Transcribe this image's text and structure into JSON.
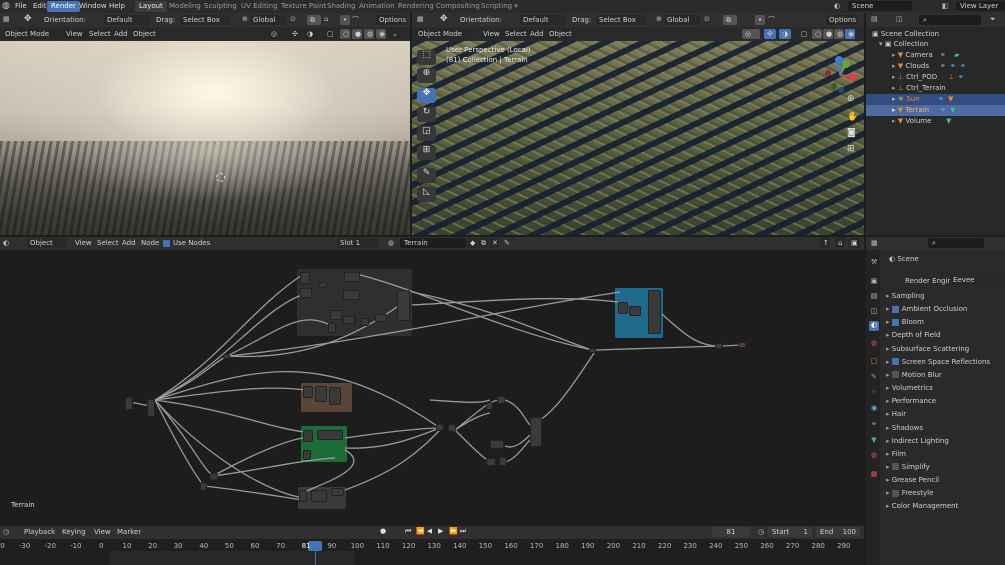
{
  "topbar": {
    "menus": [
      "File",
      "Edit",
      "Render",
      "Window",
      "Help"
    ],
    "workspaces": [
      "Layout",
      "Modeling",
      "Sculpting",
      "UV Editing",
      "Texture Paint",
      "Shading",
      "Animation",
      "Rendering",
      "Compositing",
      "Scripting"
    ],
    "active_workspace": "Layout",
    "scene": "Scene",
    "view_layer": "View Layer"
  },
  "viewport_left": {
    "orientation_label": "Orientation:",
    "orientation_value": "Default",
    "drag_label": "Drag:",
    "drag_value": "Select Box",
    "transform": "Global",
    "options": "Options",
    "mode": "Object Mode",
    "menus": [
      "View",
      "Select",
      "Add",
      "Object"
    ]
  },
  "viewport_right": {
    "orientation_label": "Orientation:",
    "orientation_value": "Default",
    "drag_label": "Drag:",
    "drag_value": "Select Box",
    "transform": "Global",
    "options": "Options",
    "mode": "Object Mode",
    "menus": [
      "View",
      "Select",
      "Add",
      "Object"
    ],
    "overlay_line1": "User Perspective (Local)",
    "overlay_line2": "(81) Collection | Terrain"
  },
  "outliner": {
    "root": "Scene Collection",
    "collection": "Collection",
    "items": [
      "Camera",
      "Clouds",
      "Ctrl_POD",
      "Ctrl_Terrain",
      "Sun",
      "Terrain",
      "Volume"
    ]
  },
  "node_editor": {
    "type": "Object",
    "menus": [
      "View",
      "Select",
      "Add",
      "Node"
    ],
    "use_nodes": "Use Nodes",
    "slot": "Slot 1",
    "material": "Terrain",
    "corner_label": "Terrain"
  },
  "properties": {
    "context": "Scene",
    "render_engine_label": "Render Engine",
    "render_engine_value": "Eevee",
    "sections": [
      {
        "label": "Sampling",
        "check": null
      },
      {
        "label": "Ambient Occlusion",
        "check": true
      },
      {
        "label": "Bloom",
        "check": true
      },
      {
        "label": "Depth of Field",
        "check": null
      },
      {
        "label": "Subsurface Scattering",
        "check": null
      },
      {
        "label": "Screen Space Reflections",
        "check": true
      },
      {
        "label": "Motion Blur",
        "check": false
      },
      {
        "label": "Volumetrics",
        "check": null
      },
      {
        "label": "Performance",
        "check": null
      },
      {
        "label": "Hair",
        "check": null
      },
      {
        "label": "Shadows",
        "check": null
      },
      {
        "label": "Indirect Lighting",
        "check": null
      },
      {
        "label": "Film",
        "check": null
      },
      {
        "label": "Simplify",
        "check": false
      },
      {
        "label": "Grease Pencil",
        "check": null
      },
      {
        "label": "Freestyle",
        "check": false
      },
      {
        "label": "Color Management",
        "check": null
      }
    ]
  },
  "timeline": {
    "menus": [
      "Playback",
      "Keying",
      "View",
      "Marker"
    ],
    "current_frame": "81",
    "start_label": "Start",
    "start_value": "1",
    "end_label": "End",
    "end_value": "100",
    "ruler": [
      "-40",
      "-30",
      "-20",
      "-10",
      "0",
      "10",
      "20",
      "30",
      "40",
      "50",
      "60",
      "70",
      "81",
      "90",
      "100",
      "110",
      "120",
      "130",
      "140",
      "150",
      "160",
      "170",
      "180",
      "190",
      "200",
      "210",
      "220",
      "230",
      "240",
      "250",
      "260",
      "270",
      "280",
      "290"
    ]
  },
  "colors": {
    "accent": "#4772b3",
    "node_blue": "#1f6a8c",
    "node_green": "#1d6b37",
    "node_brown": "#5b4538"
  }
}
